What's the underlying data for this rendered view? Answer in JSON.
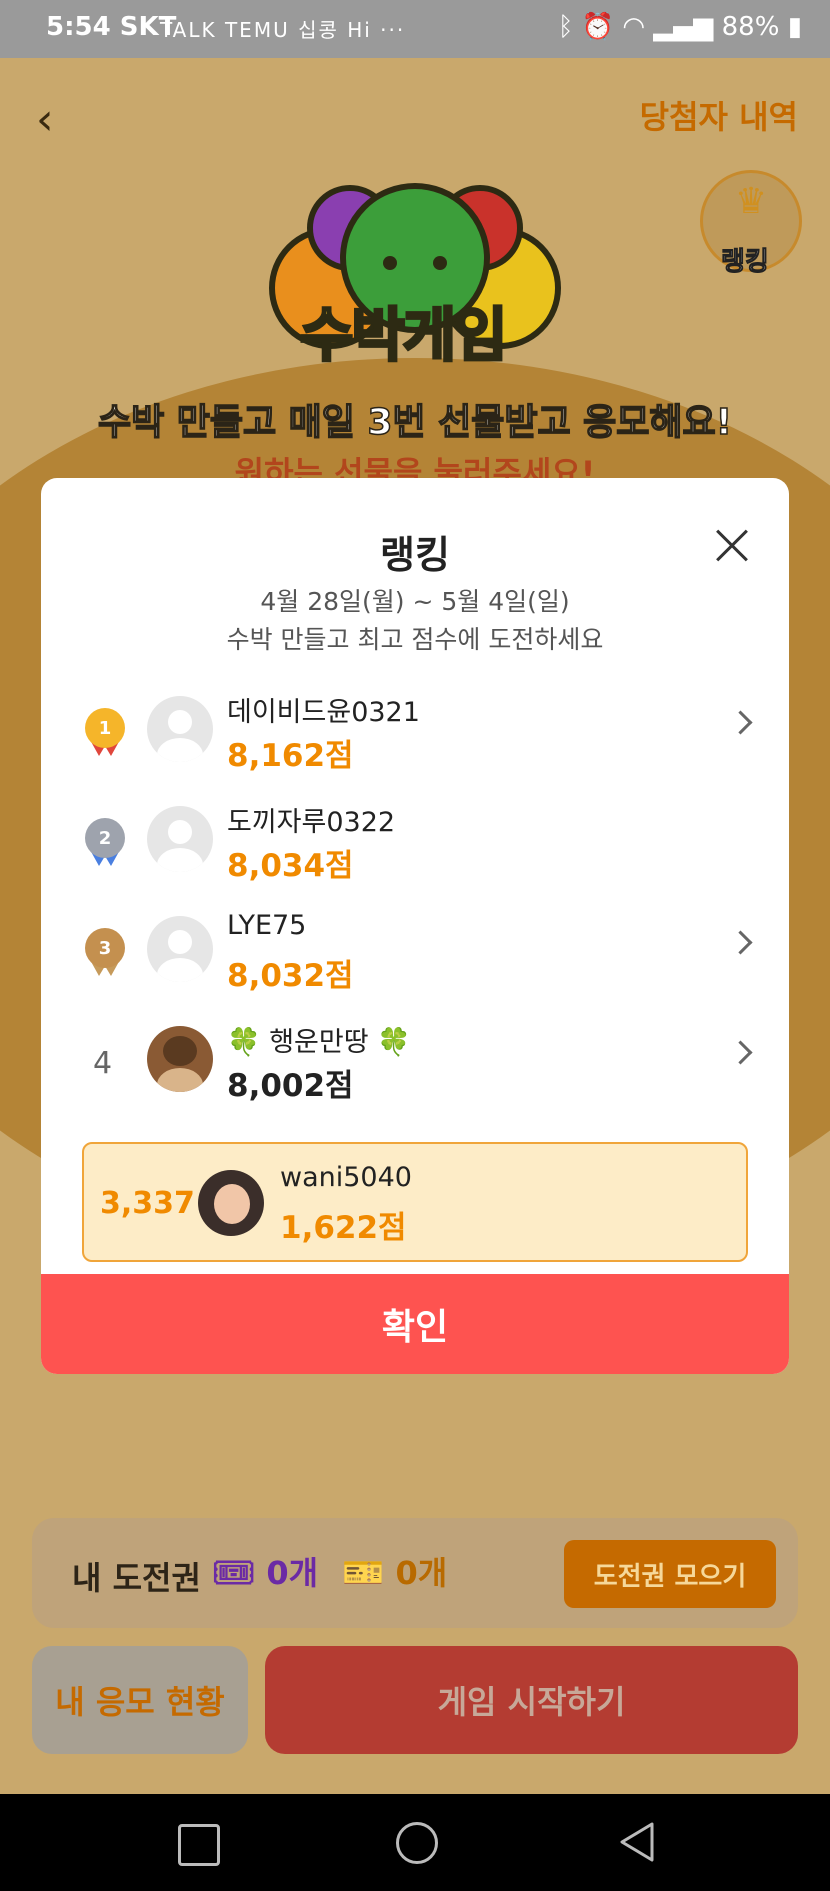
{
  "status_bar": {
    "time": "5:54 SKT",
    "notifications": "TALK TEMU 십콩 Hi ···",
    "battery": "88%"
  },
  "page": {
    "winners_link": "당첨자 내역",
    "game_logo_text": "수박게임",
    "ranking_badge": "랭킹",
    "headline": "수박 만들고 매일 3번 선물받고 응모해요!",
    "subheadline": "원하는 선물을 눌러주세요!",
    "my_tickets_label": "내 도전권",
    "ticket_purple_count": "0개",
    "ticket_gold_count": "0개",
    "collect_tickets_button": "도전권 모으기",
    "my_entries_button": "내 응모 현황",
    "start_game_button": "게임 시작하기"
  },
  "modal": {
    "title": "랭킹",
    "date_range": "4월 28일(월) ~ 5월 4일(일)",
    "description": "수박 만들고 최고 점수에 도전하세요",
    "rankings": [
      {
        "rank": "1",
        "nickname": "데이비드윤0321",
        "score": "8,162점"
      },
      {
        "rank": "2",
        "nickname": "도끼자루0322",
        "score": "8,034점"
      },
      {
        "rank": "3",
        "nickname": "LYE75",
        "score": "8,032점"
      },
      {
        "rank": "4",
        "nickname": "🍀 행운만땅 🍀",
        "score": "8,002점"
      }
    ],
    "my_entry": {
      "rank": "3,337",
      "nickname": "wani5040",
      "score": "1,622점"
    },
    "confirm_button": "확인"
  },
  "colors": {
    "accent_orange": "#f08a00",
    "confirm_red": "#fe5350",
    "highlight_bg": "#fdecc7"
  }
}
